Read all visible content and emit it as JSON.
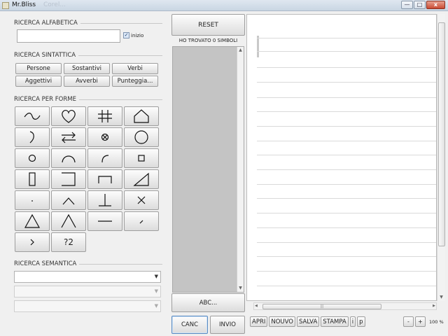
{
  "window": {
    "title": "Mr.Bliss",
    "ghost_title": "Corel...",
    "controls": {
      "minimize": "—",
      "maximize": "□",
      "close": "x"
    }
  },
  "alpha_search": {
    "title": "RICERCA ALFABETICA",
    "input_value": "",
    "checkbox_label": "inizio",
    "checkbox_checked": true
  },
  "syntactic_search": {
    "title": "RICERCA SINTATTICA",
    "buttons": [
      "Persone",
      "Sostantivi",
      "Verbi",
      "Aggettivi",
      "Avverbi",
      "Punteggia..."
    ]
  },
  "shape_search": {
    "title": "RICERCA PER FORME",
    "shapes": [
      "tilde-icon",
      "heart-icon",
      "hash-icon",
      "house-icon",
      "hook-icon",
      "swap-arrows-icon",
      "circle-cross-icon",
      "large-circle-icon",
      "small-circle-icon",
      "arch-icon",
      "corner-arc-icon",
      "small-square-icon",
      "tall-rectangle-icon",
      "bracket-right-icon",
      "table-shape-icon",
      "right-triangle-icon",
      "dot-icon",
      "caret-up-icon",
      "perpendicular-icon",
      "times-icon",
      "triangle-icon",
      "lambda-icon",
      "horizontal-line-icon",
      "short-slash-icon",
      "chevron-right-icon",
      "question-two-icon"
    ],
    "question_two_label": "?2"
  },
  "semantic_search": {
    "title": "RICERCA SEMANTICA",
    "combo1_value": "",
    "combo2_value": "",
    "combo3_value": ""
  },
  "middle": {
    "reset_label": "RESET",
    "found_text": "HO TROVATO 0 SIMBOLI",
    "abc_label": "ABC...",
    "canc_label": "CANC",
    "invio_label": "INVIO"
  },
  "editor": {
    "toolbar": [
      "APRI",
      "NOUVO",
      "SALVA",
      "STAMPA",
      "i",
      "p"
    ],
    "zoom_minus": "-",
    "zoom_plus": "+",
    "zoom_level": "100 %"
  }
}
